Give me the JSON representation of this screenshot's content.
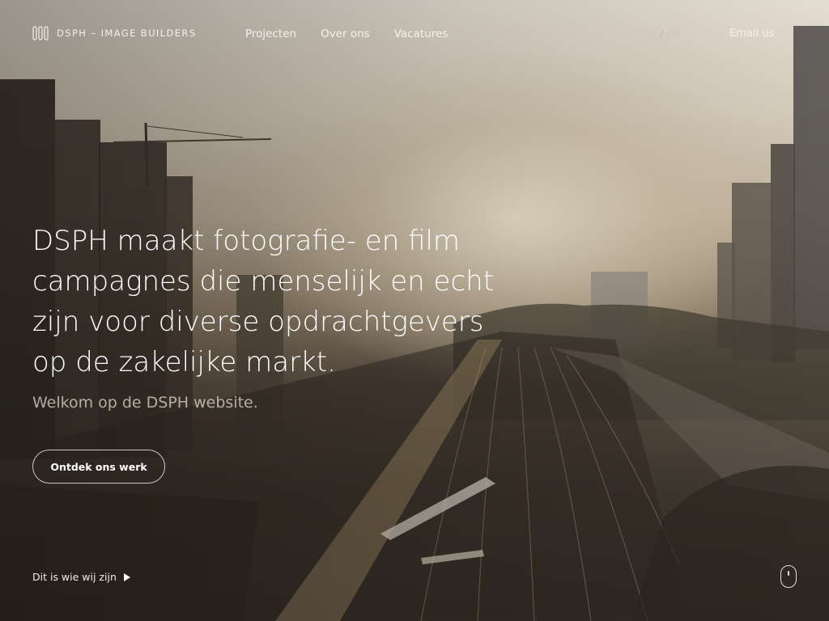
{
  "header": {
    "logo_text": "DSPH – IMAGE BUILDERS",
    "nav": [
      {
        "label": "Projecten"
      },
      {
        "label": "Over ons"
      },
      {
        "label": "Vacatures"
      }
    ],
    "lang": {
      "nl": "NL",
      "separator": "/",
      "en": "EN"
    },
    "email_label": "Email us"
  },
  "hero": {
    "headline_lines": [
      "DSPH maakt fotografie- en film",
      "campagnes die menselijk en echt",
      "zijn voor diverse opdrachtgevers",
      "op de zakelijke markt."
    ],
    "subline": "Welkom op de DSPH website.",
    "cta_label": "Ontdek ons werk",
    "who_label": "Dit is wie wij zijn",
    "icons": {
      "play": "play-icon",
      "scroll": "mouse-scroll-icon",
      "logo": "dsph-logo-mark"
    }
  },
  "colors": {
    "text": "#ffffff",
    "sky": "#e4ddd2",
    "ground": "#302a24"
  }
}
